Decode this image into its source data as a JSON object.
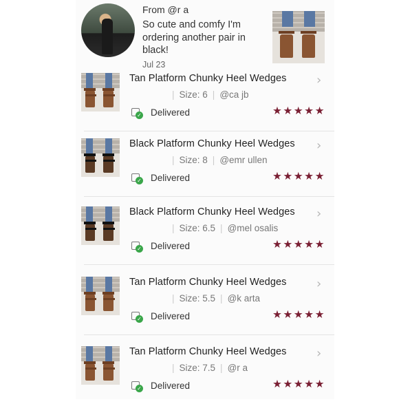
{
  "review": {
    "from": "From @r a",
    "text": "So cute and comfy I'm ordering another pair in black!",
    "date": "Jul 23"
  },
  "icons": {
    "row_arrow": "chevron-right-icon",
    "delivered": "package-check-icon",
    "rating": "star-icon"
  },
  "colors": {
    "stars": "#7a1f33",
    "delivered_check": "#3aa64a"
  },
  "orders": [
    {
      "title": "Tan Platform Chunky Heel Wedges",
      "size": "Size: 6",
      "buyer": "@ca  jb",
      "status": "Delivered",
      "stars": "★★★★★",
      "rating": 5,
      "color": "tan"
    },
    {
      "title": "Black Platform Chunky Heel Wedges",
      "size": "Size: 8",
      "buyer": "@emr        ullen",
      "status": "Delivered",
      "stars": "★★★★★",
      "rating": 5,
      "color": "black"
    },
    {
      "title": "Black Platform Chunky Heel Wedges",
      "size": "Size: 6.5",
      "buyer": "@mel      osalis",
      "status": "Delivered",
      "stars": "★★★★★",
      "rating": 5,
      "color": "black"
    },
    {
      "title": "Tan Platform Chunky Heel Wedges",
      "size": "Size: 5.5",
      "buyer": "@k     arta",
      "status": "Delivered",
      "stars": "★★★★★",
      "rating": 5,
      "color": "tan"
    },
    {
      "title": "Tan Platform Chunky Heel Wedges",
      "size": "Size: 7.5",
      "buyer": "@r   a",
      "status": "Delivered",
      "stars": "★★★★★",
      "rating": 5,
      "color": "tan"
    }
  ]
}
